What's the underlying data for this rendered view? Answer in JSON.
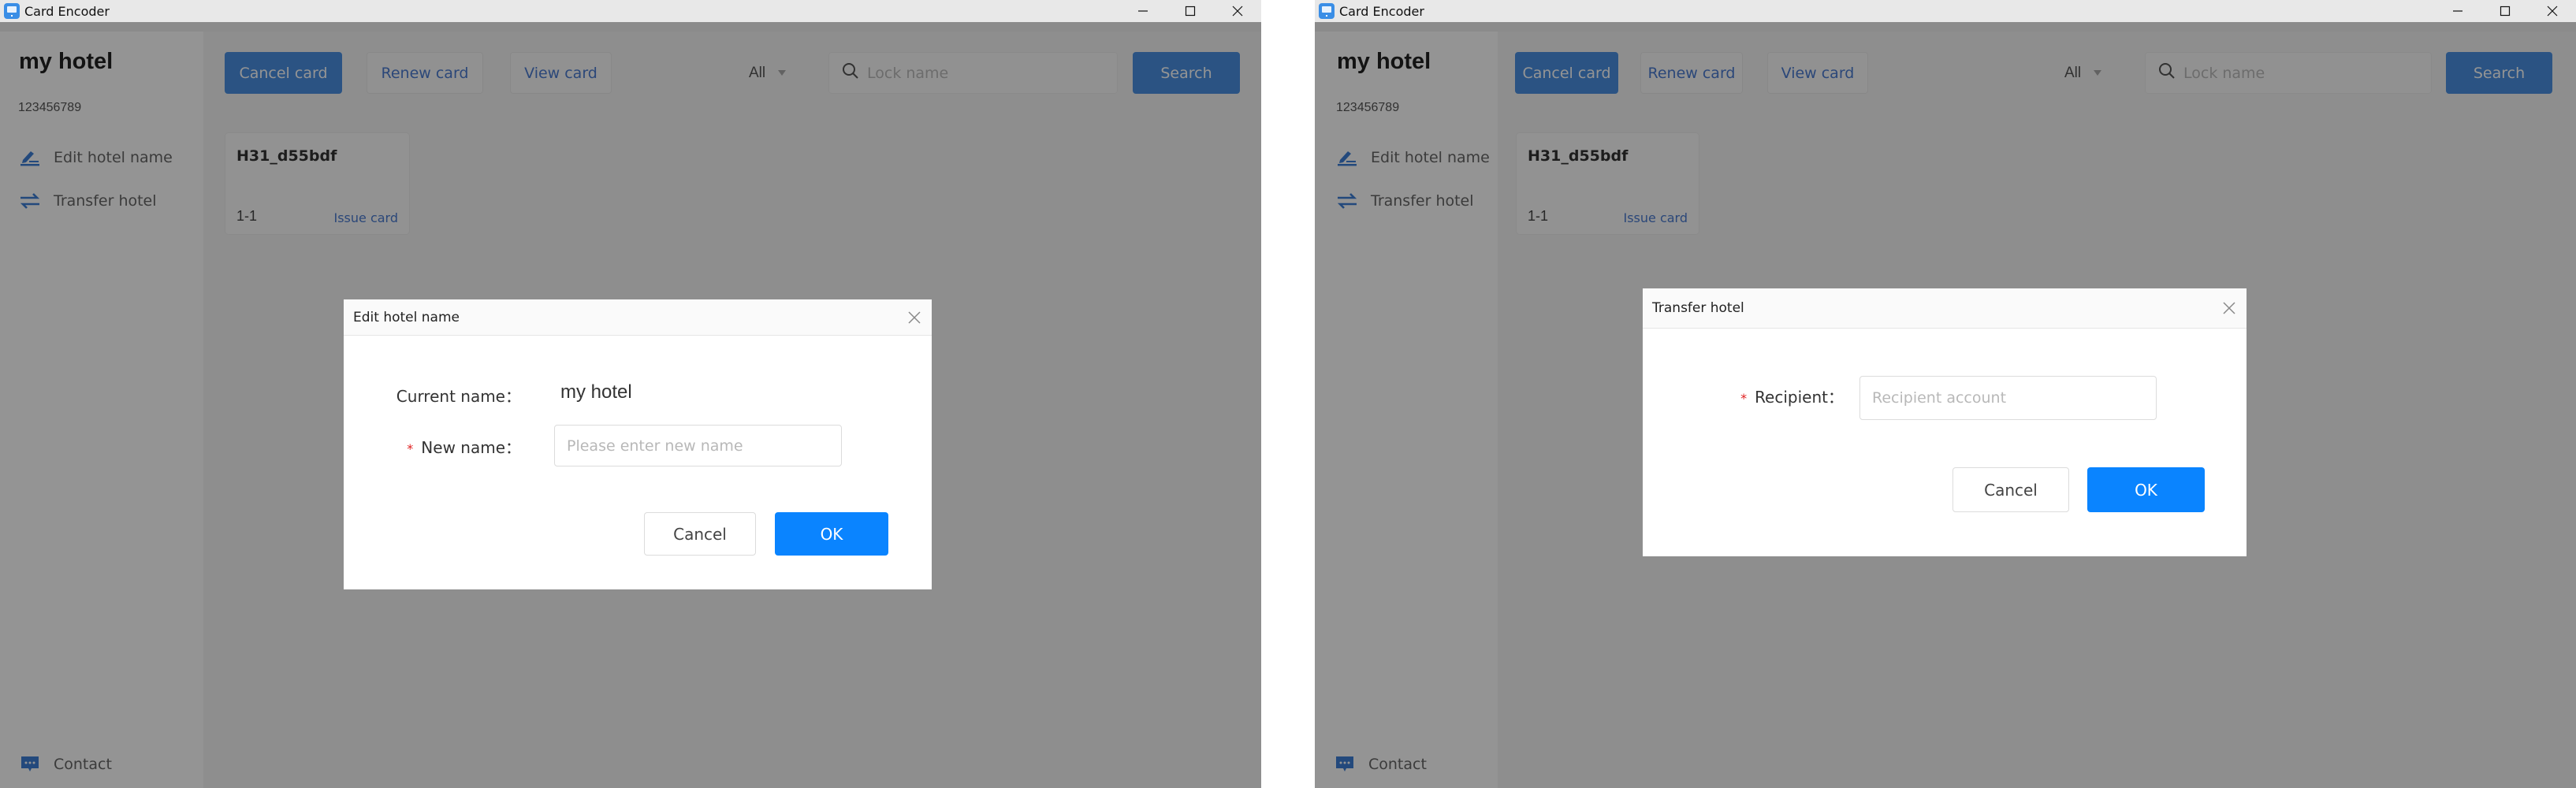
{
  "windows": [
    {
      "id": "left",
      "title": "Card Encoder",
      "controls": {
        "minimize": "minimize-icon",
        "maximize": "maximize-icon",
        "close": "close-icon"
      },
      "sidebar": {
        "hotel_name": "my hotel",
        "hotel_id": "123456789",
        "items": [
          {
            "label": "Edit hotel name",
            "icon": "edit-pen-icon"
          },
          {
            "label": "Transfer hotel",
            "icon": "transfer-arrows-icon"
          }
        ],
        "contact": {
          "label": "Contact",
          "icon": "chat-bubble-icon"
        }
      },
      "toolbar": {
        "cancel_card": "Cancel card",
        "renew_card": "Renew card",
        "view_card": "View card",
        "filter_value": "All",
        "search_placeholder": "Lock name",
        "search_button": "Search"
      },
      "cards": [
        {
          "name": "H31_d55bdf",
          "room": "1-1",
          "action": "Issue card"
        }
      ],
      "dialog": {
        "title": "Edit hotel name",
        "current_name_label": "Current name：",
        "current_name_value": "my hotel",
        "new_name_label": "New name：",
        "new_name_required": "*",
        "new_name_placeholder": "Please enter new name",
        "new_name_value": "",
        "cancel": "Cancel",
        "ok": "OK"
      }
    },
    {
      "id": "right",
      "title": "Card Encoder",
      "controls": {
        "minimize": "minimize-icon",
        "maximize": "maximize-icon",
        "close": "close-icon"
      },
      "sidebar": {
        "hotel_name": "my hotel",
        "hotel_id": "123456789",
        "items": [
          {
            "label": "Edit hotel name",
            "icon": "edit-pen-icon"
          },
          {
            "label": "Transfer hotel",
            "icon": "transfer-arrows-icon"
          }
        ],
        "contact": {
          "label": "Contact",
          "icon": "chat-bubble-icon"
        }
      },
      "toolbar": {
        "cancel_card": "Cancel card",
        "renew_card": "Renew card",
        "view_card": "View card",
        "filter_value": "All",
        "search_placeholder": "Lock name",
        "search_button": "Search"
      },
      "cards": [
        {
          "name": "H31_d55bdf",
          "room": "1-1",
          "action": "Issue card"
        }
      ],
      "dialog": {
        "title": "Transfer hotel",
        "recipient_label": "Recipient：",
        "recipient_required": "*",
        "recipient_placeholder": "Recipient account",
        "recipient_value": "",
        "cancel": "Cancel",
        "ok": "OK"
      }
    }
  ],
  "colors": {
    "primary": "#4a90e2",
    "ok_button": "#0a84ff",
    "link": "#4a7bd0",
    "required": "#e02020"
  }
}
